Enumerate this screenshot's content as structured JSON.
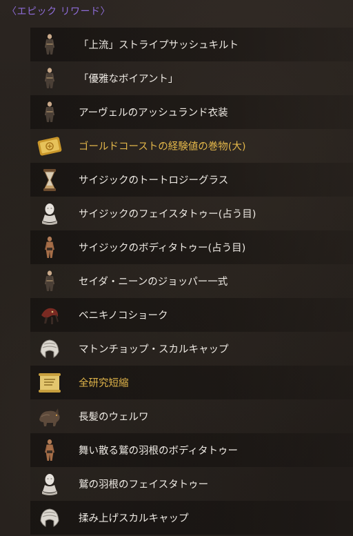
{
  "header": {
    "title": "〈エピック リワード〉"
  },
  "rewards": [
    {
      "label": "「上流」ストライプサッシュキルト",
      "icon": "costume-figure-icon",
      "highlight": false
    },
    {
      "label": "「優雅なボイアント」",
      "icon": "costume-figure-icon",
      "highlight": false
    },
    {
      "label": "アーヴェルのアッシュランド衣装",
      "icon": "costume-figure-icon",
      "highlight": false
    },
    {
      "label": "ゴールドコーストの経験値の巻物(大)",
      "icon": "gold-scroll-icon",
      "highlight": true
    },
    {
      "label": "サイジックのトートロジーグラス",
      "icon": "hourglass-icon",
      "highlight": false
    },
    {
      "label": "サイジックのフェイスタトゥー(占う目)",
      "icon": "bust-icon",
      "highlight": false
    },
    {
      "label": "サイジックのボディタトゥー(占う目)",
      "icon": "body-figure-icon",
      "highlight": false
    },
    {
      "label": "セイダ・ニーンのジョッパー一式",
      "icon": "costume-figure-icon",
      "highlight": false
    },
    {
      "label": "ベニキノコショーク",
      "icon": "mushroom-creature-icon",
      "highlight": false
    },
    {
      "label": "マトンチョップ・スカルキャップ",
      "icon": "skullcap-icon",
      "highlight": false
    },
    {
      "label": "全研究短縮",
      "icon": "research-scroll-icon",
      "highlight": true
    },
    {
      "label": "長髪のウェルワ",
      "icon": "wolf-creature-icon",
      "highlight": false
    },
    {
      "label": "舞い散る鷲の羽根のボディタトゥー",
      "icon": "body-figure-icon",
      "highlight": false
    },
    {
      "label": "鷲の羽根のフェイスタトゥー",
      "icon": "bust-icon",
      "highlight": false
    },
    {
      "label": "揉み上げスカルキャップ",
      "icon": "skullcap-icon",
      "highlight": false
    }
  ],
  "colors": {
    "header": "#8e6cd8",
    "label": "#eeeae4",
    "gold_label": "#e2b64a"
  }
}
